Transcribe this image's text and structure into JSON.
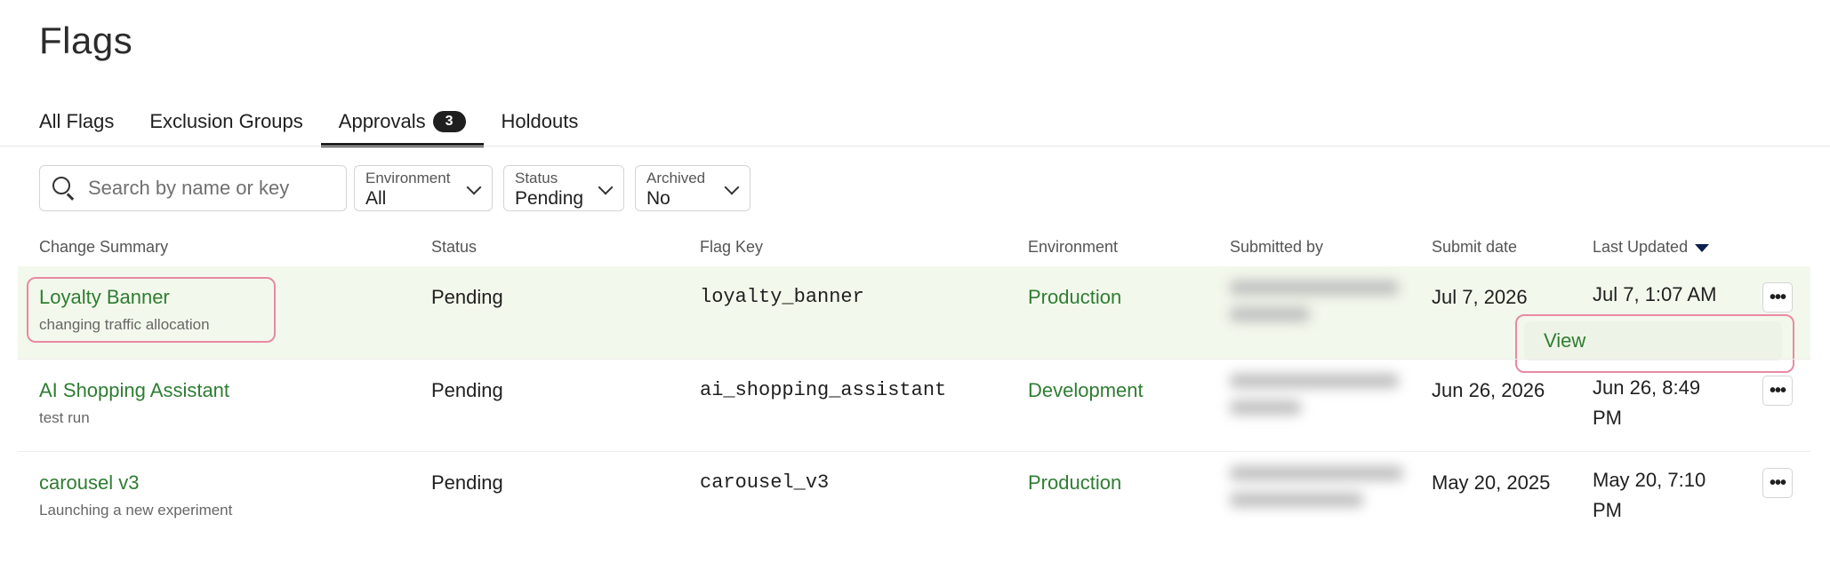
{
  "page": {
    "title": "Flags"
  },
  "tabs": [
    {
      "label": "All Flags"
    },
    {
      "label": "Exclusion Groups"
    },
    {
      "label": "Approvals",
      "badge": "3"
    },
    {
      "label": "Holdouts"
    }
  ],
  "search": {
    "placeholder": "Search by name or key",
    "value": ""
  },
  "filters": [
    {
      "label": "Environment",
      "value": "All"
    },
    {
      "label": "Status",
      "value": "Pending"
    },
    {
      "label": "Archived",
      "value": "No"
    }
  ],
  "table": {
    "columns": [
      "Change Summary",
      "Status",
      "Flag Key",
      "Environment",
      "Submitted by",
      "Submit date",
      "Last Updated"
    ],
    "sort": {
      "column": "Last Updated",
      "direction": "desc"
    },
    "rows": [
      {
        "title": "Loyalty Banner",
        "description": "changing traffic allocation",
        "status": "Pending",
        "flag_key": "loyalty_banner",
        "environment": "Production",
        "submit_date": "Jul 7, 2026",
        "last_updated": "Jul 7, 1:07 AM"
      },
      {
        "title": "AI Shopping Assistant",
        "description": "test run",
        "status": "Pending",
        "flag_key": "ai_shopping_assistant",
        "environment": "Development",
        "submit_date": "Jun 26, 2026",
        "last_updated": "Jun 26, 8:49 PM"
      },
      {
        "title": "carousel v3",
        "description": "Launching a new experiment",
        "status": "Pending",
        "flag_key": "carousel_v3",
        "environment": "Production",
        "submit_date": "May 20, 2025",
        "last_updated": "May 20, 7:10 PM"
      }
    ]
  },
  "row_menu": {
    "items": [
      {
        "label": "View"
      }
    ]
  },
  "icons": {
    "search": "search-icon",
    "chevron": "chevron-down-icon",
    "sort": "sort-descending-icon",
    "more": "more-horizontal-icon"
  },
  "colors": {
    "accent_green": "#2e7d32",
    "highlight_row": "#f3f8ec",
    "focus_ring": "#e88aa3"
  }
}
